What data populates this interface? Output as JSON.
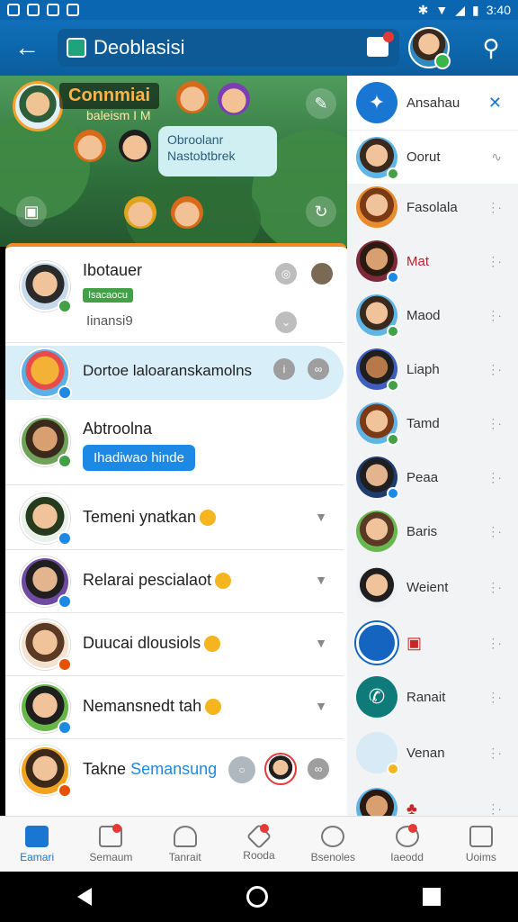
{
  "status": {
    "time": "3:40"
  },
  "appbar": {
    "title": "Deoblasisi"
  },
  "banner": {
    "title": "Connmiai",
    "subtitle": "baleism I M",
    "speech": "Obroolanr Nastobtbrek"
  },
  "chats": [
    {
      "name": "Ibotauer",
      "chip": "Isacaocu",
      "sub": "Iinansi9"
    },
    {
      "name": "Dortoe laloaranskamolns"
    },
    {
      "name": "Abtroolna",
      "action": "Ihadiwao hinde"
    },
    {
      "name": "Temeni ynatkan"
    },
    {
      "name": "Relarai pescialaot"
    },
    {
      "name": "Duucai dlousiols"
    },
    {
      "name": "Nemansnedt tah"
    },
    {
      "name": "Takne",
      "name_highlight": "Semansung"
    }
  ],
  "sidebar": [
    {
      "name": "Ansahau",
      "badge": "",
      "accent": "#1976d2"
    },
    {
      "name": "Oorut"
    },
    {
      "name": "Fasolala"
    },
    {
      "name": "Mat",
      "accent": "#b3262d"
    },
    {
      "name": "Maod"
    },
    {
      "name": "Liaph"
    },
    {
      "name": "Tamd"
    },
    {
      "name": "Peaa"
    },
    {
      "name": "Baris"
    },
    {
      "name": "Weient"
    },
    {
      "name": ""
    },
    {
      "name": "Ranait"
    },
    {
      "name": "Venan"
    },
    {
      "name": ""
    }
  ],
  "nav": [
    {
      "label": "Eamari"
    },
    {
      "label": "Semaum"
    },
    {
      "label": "Tanrait"
    },
    {
      "label": "Rooda"
    },
    {
      "label": "Bsenoles"
    },
    {
      "label": "Iaeodd"
    },
    {
      "label": "Uoims"
    }
  ]
}
